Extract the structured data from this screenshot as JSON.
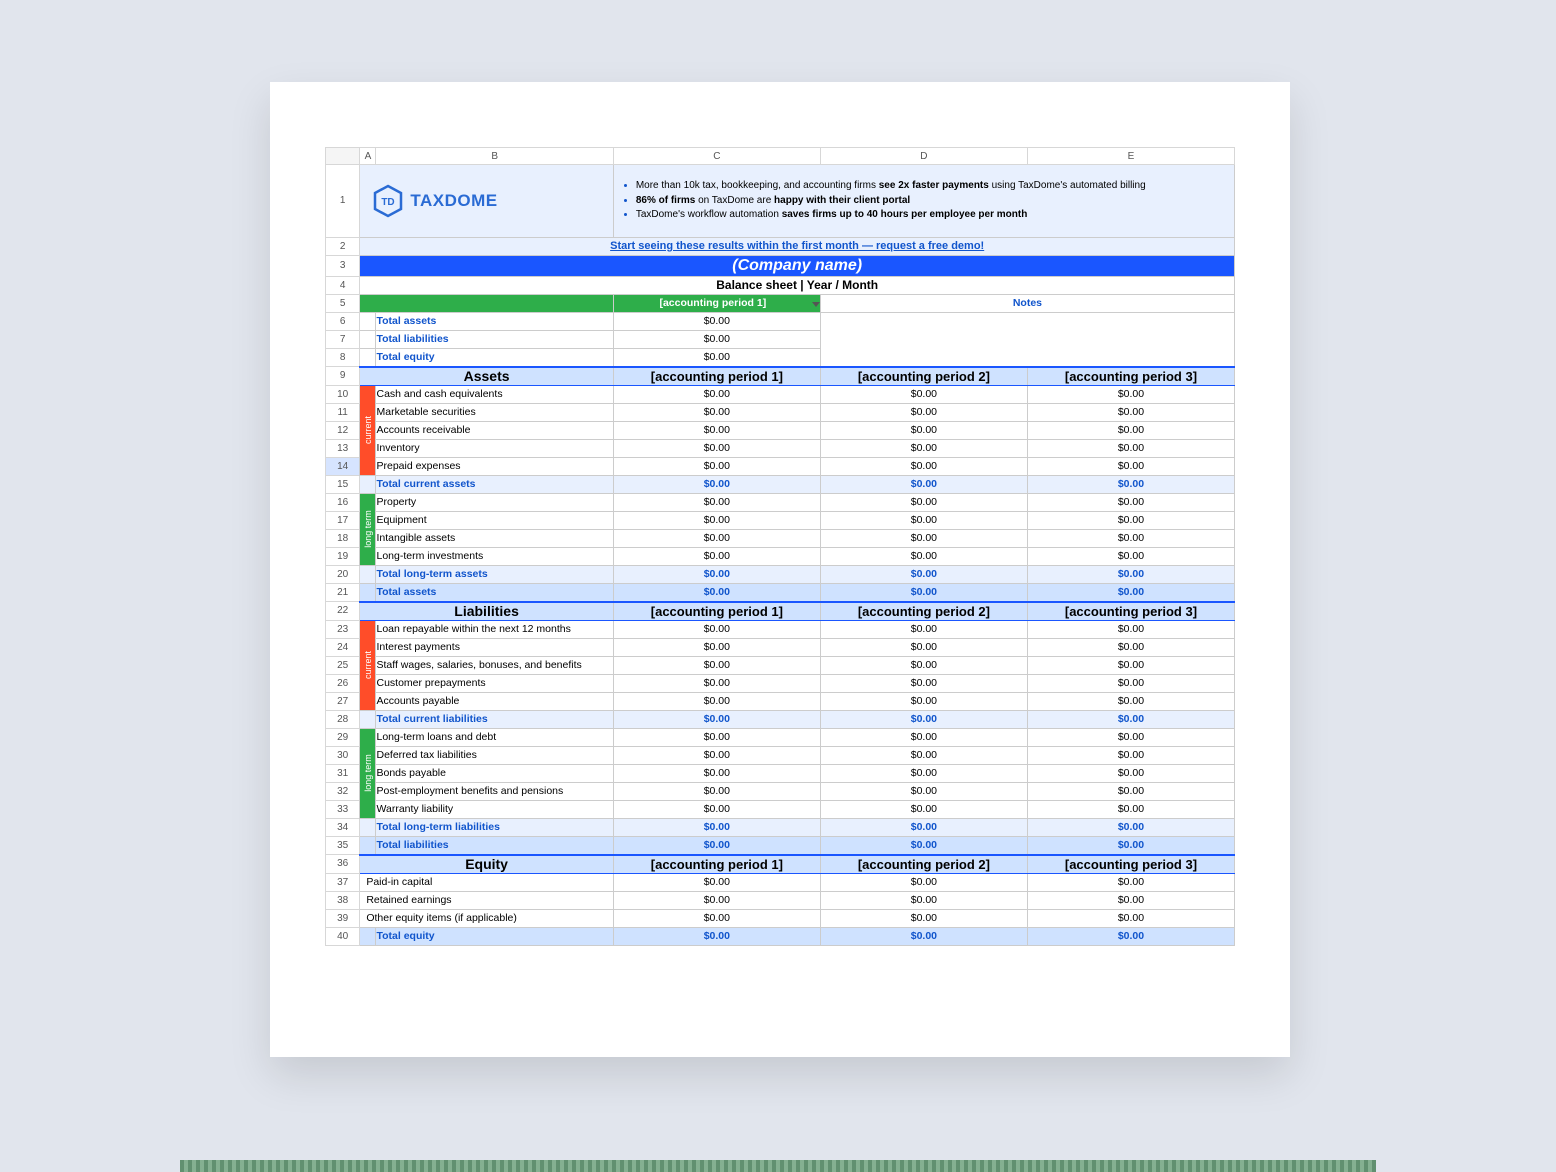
{
  "columns": [
    "A",
    "B",
    "C",
    "D",
    "E"
  ],
  "logo": {
    "badge": "TD",
    "name": "TAXDOME"
  },
  "banner": {
    "bullets": [
      {
        "pre": "More than 10k tax, bookkeeping, and accounting firms ",
        "bold": "see 2x faster payments",
        "post": " using TaxDome's automated billing"
      },
      {
        "pre": "",
        "bold": "86% of firms",
        "post_pre": " on TaxDome are ",
        "bold2": "happy with their client portal",
        "post": ""
      },
      {
        "pre": "TaxDome's workflow automation ",
        "bold": "saves firms up to 40 hours per employee per month",
        "post": ""
      }
    ],
    "demo_link": "Start seeing these results within the first month — request a free demo!"
  },
  "company_name": "(Company name)",
  "subtitle": "Balance sheet | Year / Month",
  "summary": {
    "period_header": "[accounting period 1]",
    "notes_header": "Notes",
    "rows": [
      {
        "label": "Total assets",
        "value": "$0.00"
      },
      {
        "label": "Total liabilities",
        "value": "$0.00"
      },
      {
        "label": "Total equity",
        "value": "$0.00"
      }
    ]
  },
  "period_headers": [
    "[accounting period 1]",
    "[accounting period 2]",
    "[accounting period 3]"
  ],
  "side_labels": {
    "current": "current",
    "longterm": "long term"
  },
  "sections": {
    "assets": {
      "title": "Assets",
      "current": [
        {
          "label": "Cash and cash equivalents",
          "v": [
            "$0.00",
            "$0.00",
            "$0.00"
          ]
        },
        {
          "label": "Marketable securities",
          "v": [
            "$0.00",
            "$0.00",
            "$0.00"
          ]
        },
        {
          "label": "Accounts receivable",
          "v": [
            "$0.00",
            "$0.00",
            "$0.00"
          ]
        },
        {
          "label": "Inventory",
          "v": [
            "$0.00",
            "$0.00",
            "$0.00"
          ]
        },
        {
          "label": "Prepaid expenses",
          "v": [
            "$0.00",
            "$0.00",
            "$0.00"
          ]
        }
      ],
      "current_total": {
        "label": "Total current assets",
        "v": [
          "$0.00",
          "$0.00",
          "$0.00"
        ]
      },
      "longterm": [
        {
          "label": "Property",
          "v": [
            "$0.00",
            "$0.00",
            "$0.00"
          ]
        },
        {
          "label": "Equipment",
          "v": [
            "$0.00",
            "$0.00",
            "$0.00"
          ]
        },
        {
          "label": "Intangible assets",
          "v": [
            "$0.00",
            "$0.00",
            "$0.00"
          ]
        },
        {
          "label": "Long-term investments",
          "v": [
            "$0.00",
            "$0.00",
            "$0.00"
          ]
        }
      ],
      "longterm_total": {
        "label": "Total long-term assets",
        "v": [
          "$0.00",
          "$0.00",
          "$0.00"
        ]
      },
      "grand": {
        "label": "Total assets",
        "v": [
          "$0.00",
          "$0.00",
          "$0.00"
        ]
      }
    },
    "liabilities": {
      "title": "Liabilities",
      "current": [
        {
          "label": "Loan repayable within the next 12 months",
          "v": [
            "$0.00",
            "$0.00",
            "$0.00"
          ]
        },
        {
          "label": "Interest payments",
          "v": [
            "$0.00",
            "$0.00",
            "$0.00"
          ]
        },
        {
          "label": "Staff wages, salaries, bonuses, and benefits",
          "v": [
            "$0.00",
            "$0.00",
            "$0.00"
          ]
        },
        {
          "label": "Customer prepayments",
          "v": [
            "$0.00",
            "$0.00",
            "$0.00"
          ]
        },
        {
          "label": "Accounts payable",
          "v": [
            "$0.00",
            "$0.00",
            "$0.00"
          ]
        }
      ],
      "current_total": {
        "label": "Total current liabilities",
        "v": [
          "$0.00",
          "$0.00",
          "$0.00"
        ]
      },
      "longterm": [
        {
          "label": "Long-term loans and debt",
          "v": [
            "$0.00",
            "$0.00",
            "$0.00"
          ]
        },
        {
          "label": "Deferred tax liabilities",
          "v": [
            "$0.00",
            "$0.00",
            "$0.00"
          ]
        },
        {
          "label": "Bonds payable",
          "v": [
            "$0.00",
            "$0.00",
            "$0.00"
          ]
        },
        {
          "label": "Post-employment benefits and pensions",
          "v": [
            "$0.00",
            "$0.00",
            "$0.00"
          ]
        },
        {
          "label": "Warranty liability",
          "v": [
            "$0.00",
            "$0.00",
            "$0.00"
          ]
        }
      ],
      "longterm_total": {
        "label": "Total long-term liabilities",
        "v": [
          "$0.00",
          "$0.00",
          "$0.00"
        ]
      },
      "grand": {
        "label": "Total liabilities",
        "v": [
          "$0.00",
          "$0.00",
          "$0.00"
        ]
      }
    },
    "equity": {
      "title": "Equity",
      "items": [
        {
          "label": "Paid-in capital",
          "v": [
            "$0.00",
            "$0.00",
            "$0.00"
          ]
        },
        {
          "label": "Retained earnings",
          "v": [
            "$0.00",
            "$0.00",
            "$0.00"
          ]
        },
        {
          "label": "Other equity items (if applicable)",
          "v": [
            "$0.00",
            "$0.00",
            "$0.00"
          ]
        }
      ],
      "grand": {
        "label": "Total equity",
        "v": [
          "$0.00",
          "$0.00",
          "$0.00"
        ]
      }
    }
  },
  "row_numbers_start": 1
}
